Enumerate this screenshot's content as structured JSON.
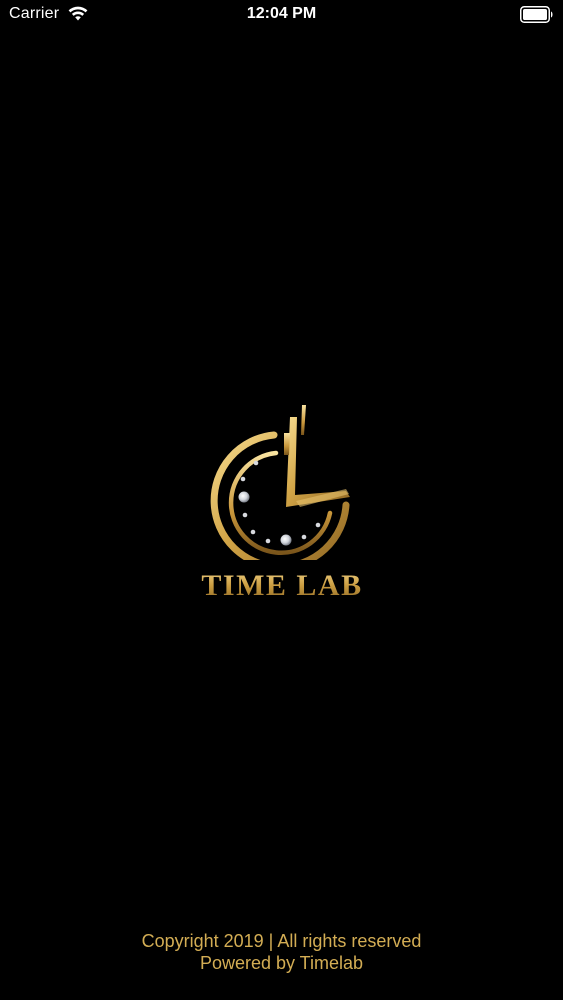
{
  "status_bar": {
    "carrier": "Carrier",
    "time": "12:04 PM",
    "icons": [
      "wifi-icon",
      "battery-icon"
    ]
  },
  "logo": {
    "icon": "clock-logo-icon",
    "wordmark": "TIME LAB"
  },
  "footer": {
    "copyright": "Copyright 2019 | All rights reserved",
    "powered_by": "Powered by Timelab"
  },
  "colors": {
    "background": "#000000",
    "gold": "#d3ad54",
    "status_text": "#ffffff"
  }
}
